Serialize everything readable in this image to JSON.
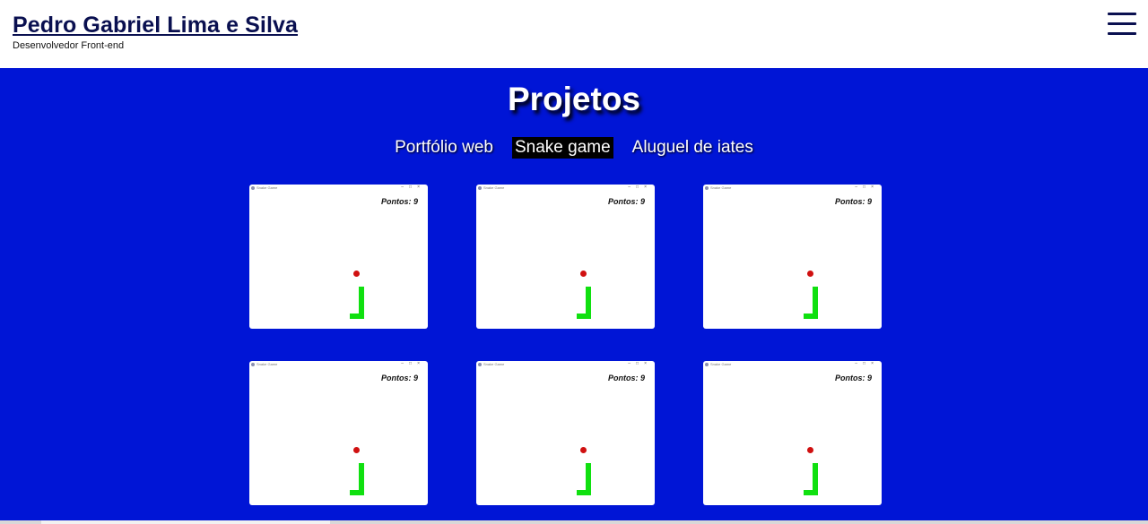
{
  "header": {
    "title": "Pedro Gabriel Lima e Silva",
    "subtitle": "Desenvolvedor Front-end",
    "menu_icon": "hamburger-menu-icon"
  },
  "main": {
    "title": "Projetos",
    "tabs": [
      {
        "label": "Portfólio web",
        "active": false
      },
      {
        "label": "Snake game",
        "active": true
      },
      {
        "label": "Aluguel de iates",
        "active": false
      }
    ],
    "cards": [
      {
        "window_title": "Snake Game",
        "score": "Pontos: 9"
      },
      {
        "window_title": "Snake Game",
        "score": "Pontos: 9"
      },
      {
        "window_title": "Snake Game",
        "score": "Pontos: 9"
      },
      {
        "window_title": "Snake Game",
        "score": "Pontos: 9"
      },
      {
        "window_title": "Snake Game",
        "score": "Pontos: 9"
      },
      {
        "window_title": "Snake Game",
        "score": "Pontos: 9"
      }
    ]
  },
  "colors": {
    "background": "#0015d6",
    "header_bg": "#ffffff",
    "title_text": "#0a1050",
    "active_tab_bg": "#000000",
    "snake": "#10e010",
    "food": "#d01010"
  }
}
